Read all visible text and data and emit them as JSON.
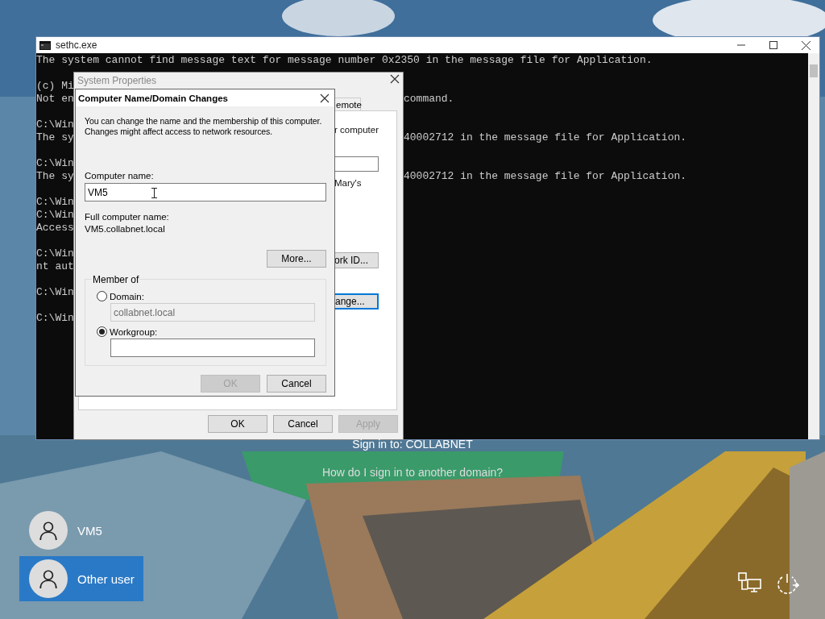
{
  "console": {
    "title": "sethc.exe",
    "lines": [
      {
        "kind": "text",
        "left": "The system cannot find message text for message number 0x2350 in the message file for Application."
      },
      {
        "kind": "blank"
      },
      {
        "kind": "text",
        "left": "(c) Mi"
      },
      {
        "kind": "text",
        "left": "Not en",
        "right": "command."
      },
      {
        "kind": "blank"
      },
      {
        "kind": "text",
        "left": "C:\\Win"
      },
      {
        "kind": "text",
        "left": "The sy",
        "right": "40002712 in the message file for Application."
      },
      {
        "kind": "blank"
      },
      {
        "kind": "text",
        "left": "C:\\Win"
      },
      {
        "kind": "text",
        "left": "The sy",
        "right": "40002712 in the message file for Application."
      },
      {
        "kind": "blank"
      },
      {
        "kind": "text",
        "left": "C:\\Win"
      },
      {
        "kind": "text",
        "left": "C:\\Win"
      },
      {
        "kind": "text",
        "left": "Access"
      },
      {
        "kind": "blank"
      },
      {
        "kind": "text",
        "left": "C:\\Win"
      },
      {
        "kind": "text",
        "left": "nt aut"
      },
      {
        "kind": "blank"
      },
      {
        "kind": "text",
        "left": "C:\\Win"
      },
      {
        "kind": "blank"
      },
      {
        "kind": "text",
        "left": "C:\\Win"
      }
    ]
  },
  "system_properties": {
    "title": "System Properties",
    "tabs": [
      {
        "label": "emote",
        "selected": false
      }
    ],
    "description_fragment": "r computer",
    "name_fragment": "Mary's",
    "network_id_button": {
      "label": "ork ID...",
      "focused": false
    },
    "change_button": {
      "label": "ange...",
      "focused": true
    },
    "buttons": [
      {
        "label": "OK",
        "disabled": false
      },
      {
        "label": "Cancel",
        "disabled": false
      },
      {
        "label": "Apply",
        "disabled": true
      }
    ]
  },
  "name_dialog": {
    "title": "Computer Name/Domain Changes",
    "description": "You can change the name and the membership of this computer. Changes might affect access to network resources.",
    "computer_name": {
      "label": "Computer name:",
      "value": "VM5"
    },
    "full_name": {
      "label": "Full computer name:",
      "value": "VM5.collabnet.local"
    },
    "more_button": "More...",
    "member_of": {
      "title": "Member of",
      "options": [
        {
          "label": "Domain:",
          "selected": false,
          "value": "collabnet.local"
        },
        {
          "label": "Workgroup:",
          "selected": true
        }
      ]
    },
    "buttons": [
      {
        "label": "OK",
        "disabled": true
      },
      {
        "label": "Cancel",
        "disabled": false
      }
    ]
  },
  "lock_screen": {
    "sign_in_to": "Sign in to: COLLABNET",
    "other_domain_link": "How do I sign in to another domain?",
    "users": [
      {
        "name": "VM5",
        "selected": false
      },
      {
        "name": "Other user",
        "selected": true
      }
    ]
  }
}
